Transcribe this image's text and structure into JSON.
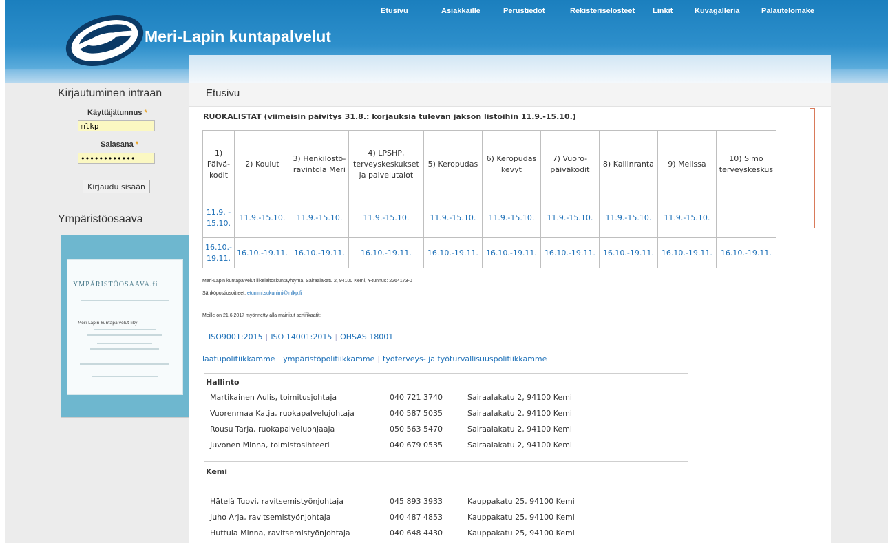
{
  "site": {
    "title": "Meri-Lapin kuntapalvelut"
  },
  "nav": [
    "Etusivu",
    "Asiakkaille",
    "Perustiedot",
    "Rekisteriselosteet",
    "Linkit",
    "Kuvagalleria",
    "Palautelomake"
  ],
  "login": {
    "title": "Kirjautuminen intraan",
    "username_label": "Käyttäjätunnus",
    "username_value": "mlkp",
    "password_label": "Salasana",
    "password_value": "••••••••••••",
    "required_marker": "*",
    "submit_label": "Kirjaudu sisään"
  },
  "env": {
    "title": "Ympäristöosaava",
    "cert_logo": "YMPÄRISTÖOSAAVA.fi",
    "cert_org": "Meri-Lapin kuntapalvelut liky"
  },
  "main": {
    "heading": "Etusivu",
    "menu_title": "RUOKALISTAT (viimeisin päivitys 31.8.: korjauksia tulevan jakson listoihin 11.9.-15.10.)",
    "table": {
      "headers": [
        "1) Päivä-kodit",
        "2) Koulut",
        "3) Henkilöstö-ravintola Meri",
        "4) LPSHP, terveyskeskukset ja palvelutalot",
        "5) Keropudas",
        "6) Keropudas kevyt",
        "7) Vuoro-päiväkodit",
        "8) Kallinranta",
        "9) Melissa",
        "10) Simo terveyskeskus"
      ],
      "row1": [
        "11.9. - 15.10.",
        "11.9.-15.10.",
        "11.9.-15.10.",
        "11.9.-15.10.",
        "11.9.-15.10.",
        "11.9.-15.10.",
        "11.9.-15.10.",
        "11.9.-15.10.",
        "11.9.-15.10.",
        ""
      ],
      "row2": [
        "16.10.- 19.11.",
        "16.10.-19.11.",
        "16.10.-19.11.",
        "16.10.-19.11.",
        "16.10.-19.11.",
        "16.10.-19.11.",
        "16.10.-19.11.",
        "16.10.-19.11.",
        "16.10.-19.11.",
        "16.10.-19.11."
      ]
    },
    "org_info": "Meri-Lapin kuntapalvelut liikelaitoskuntayhtymä, Sairaalakatu 2, 94100 Kemi, Y-tunnus: 2264173-0",
    "email_label": "Sähköpostiosoitteet:",
    "email_value": "etunimi.sukunimi@mlkp.fi",
    "cert_note": "Meille on 21.6.2017 myönnetty alla mainitut sertifikaatit:",
    "certs": [
      "ISO9001:2015",
      "ISO 14001:2015",
      "OHSAS 18001"
    ],
    "policies": [
      "laatupolitiikkamme",
      "ympäristöpolitiikkamme",
      "työterveys- ja työturvallisuuspolitiikkamme"
    ],
    "hallinto": {
      "title": "Hallinto",
      "contacts": [
        {
          "name": "Martikainen Aulis, toimitusjohtaja",
          "phone": "040 721 3740",
          "address": "Sairaalakatu 2, 94100 Kemi"
        },
        {
          "name": "Vuorenmaa Katja, ruokapalvelujohtaja",
          "phone": "040 587 5035",
          "address": "Sairaalakatu 2, 94100 Kemi"
        },
        {
          "name": "Rousu Tarja, ruokapalveluohjaaja",
          "phone": "050 563 5470",
          "address": "Sairaalakatu 2, 94100 Kemi"
        },
        {
          "name": "Juvonen Minna, toimistosihteeri",
          "phone": "040 679 0535",
          "address": "Sairaalakatu 2, 94100 Kemi"
        }
      ]
    },
    "kemi": {
      "title": "Kemi",
      "contacts": [
        {
          "name": "Hätelä Tuovi, ravitsemistyönjohtaja",
          "phone": "045 893 3933",
          "address": "Kauppakatu 25, 94100 Kemi"
        },
        {
          "name": "Juho Arja, ravitsemistyönjohtaja",
          "phone": "040 487 4853",
          "address": "Kauppakatu 25, 94100 Kemi"
        },
        {
          "name": "Huttula Minna, ravitsemistyönjohtaja",
          "phone": "040 648 4430",
          "address": "Kauppakatu 25, 94100 Kemi"
        }
      ]
    }
  }
}
